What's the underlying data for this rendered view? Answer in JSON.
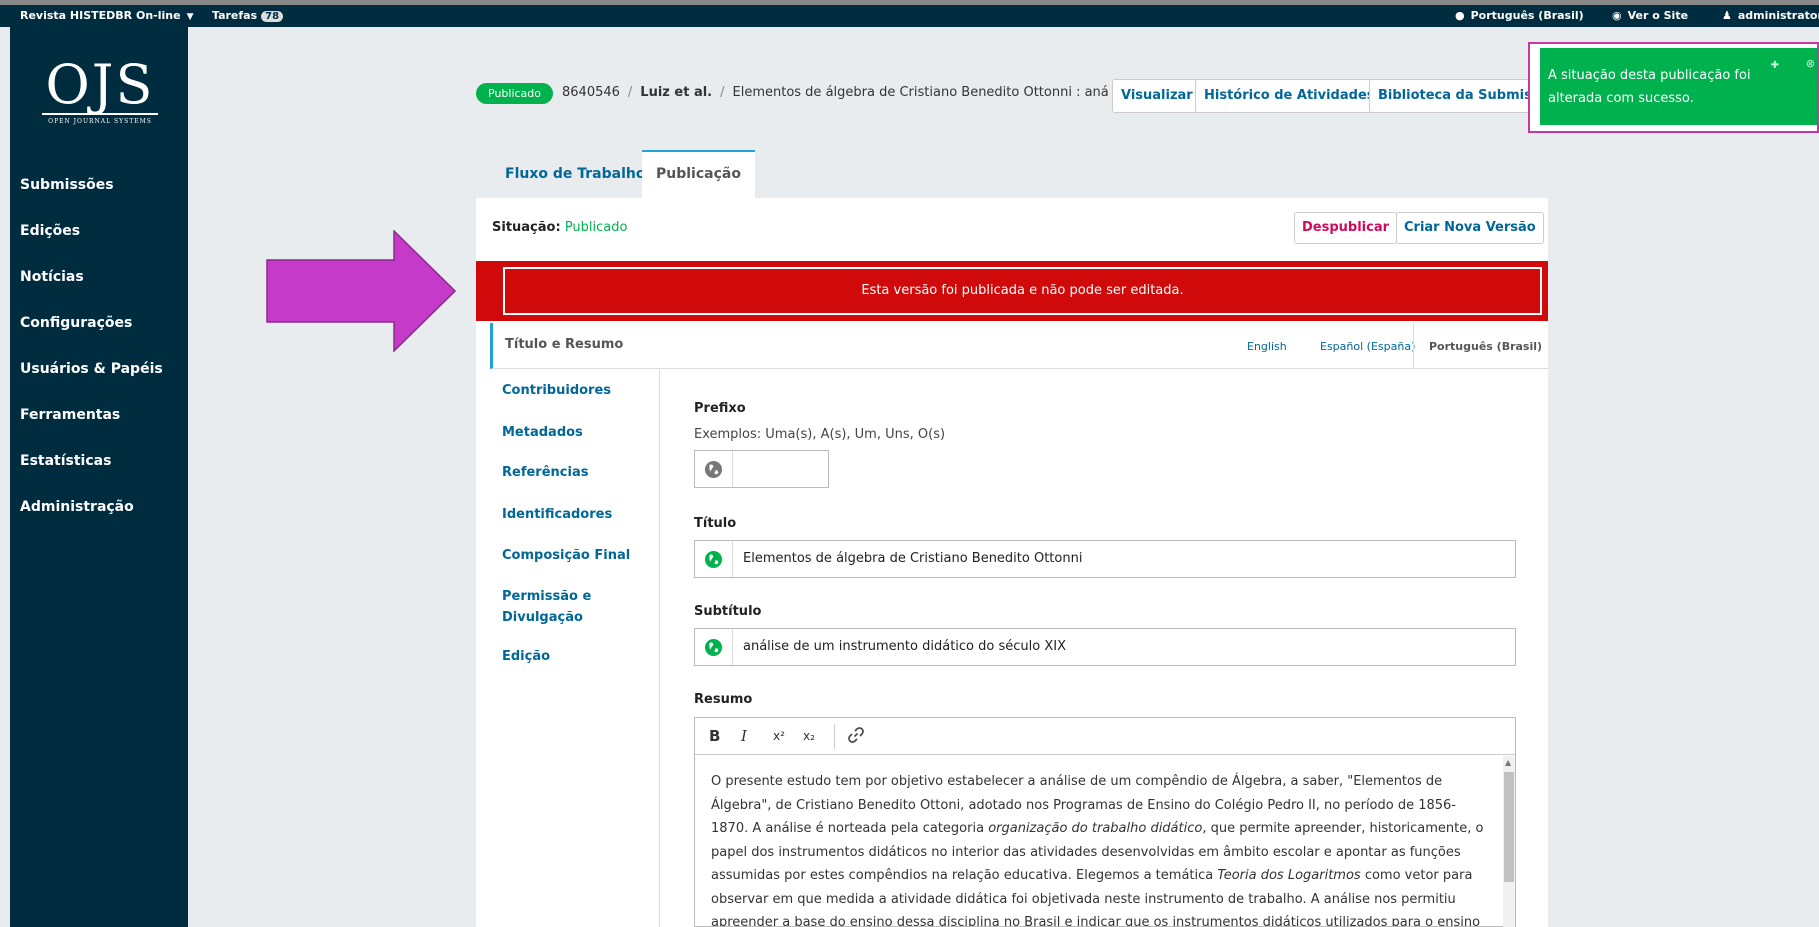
{
  "topbar": {
    "context": "Revista HISTEDBR On-line",
    "tasks_label": "Tarefas",
    "tasks_count": "78",
    "language": "Português (Brasil)",
    "view_site": "Ver o Site",
    "user": "administrator"
  },
  "logo": {
    "big": "OJS",
    "small": "OPEN JOURNAL SYSTEMS"
  },
  "sidebar": {
    "items": [
      {
        "label": "Submissões"
      },
      {
        "label": "Edições"
      },
      {
        "label": "Notícias"
      },
      {
        "label": "Configurações"
      },
      {
        "label": "Usuários & Papéis"
      },
      {
        "label": "Ferramentas"
      },
      {
        "label": "Estatísticas"
      },
      {
        "label": "Administração"
      }
    ]
  },
  "header": {
    "status": "Publicado",
    "submission_id": "8640546",
    "authors": "Luiz et al.",
    "title": "Elementos de álgebra de Cristiano Benedito Ottonni : aná",
    "sep": "/",
    "buttons": {
      "view": "Visualizar",
      "history": "Histórico de Atividades",
      "library": "Biblioteca da Submissão"
    }
  },
  "notification": {
    "text": "A situação desta publicação foi alterada com sucesso."
  },
  "tabs": {
    "workflow": "Fluxo de Trabalho",
    "publication": "Publicação"
  },
  "panel": {
    "status_label": "Situação:",
    "status_value": "Publicado",
    "unpublish": "Despublicar",
    "new_version": "Criar Nova Versão",
    "banner": "Esta versão foi publicada e não pode ser editada.",
    "section_title": "Título e Resumo",
    "languages": {
      "en": "English",
      "es": "Español (España)",
      "pt": "Português (Brasil)"
    }
  },
  "subnav": {
    "contributors": "Contribuidores",
    "metadata": "Metadados",
    "references": "Referências",
    "identifiers": "Identificadores",
    "galleys": "Composição Final",
    "permissions_1": "Permissão e",
    "permissions_2": "Divulgação",
    "issue": "Edição"
  },
  "form": {
    "prefix_label": "Prefixo",
    "prefix_hint": "Exemplos: Uma(s), A(s), Um, Uns, O(s)",
    "prefix_value": "",
    "title_label": "Título",
    "title_value": "Elementos de álgebra de Cristiano Benedito Ottonni",
    "subtitle_label": "Subtítulo",
    "subtitle_value": "análise de um instrumento didático do século XIX",
    "abstract_label": "Resumo",
    "toolbar": {
      "bold": "B",
      "italic": "I",
      "superscript": "x²",
      "subscript": "x₂"
    },
    "abstract": {
      "p1": "O presente estudo tem por objetivo estabelecer a análise de um compêndio de Álgebra, a saber, \"Elementos de Álgebra\", de Cristiano Benedito Ottoni, adotado nos Programas de Ensino do Colégio Pedro II, no período de 1856-1870. A análise é norteada pela categoria ",
      "i1": "organização do trabalho didático",
      "p2": ", que permite apreender, historicamente, o papel dos instrumentos didáticos no interior das atividades desenvolvidas em âmbito escolar e apontar as funções assumidas por estes compêndios na relação educativa. Elegemos a temática ",
      "i2": "Teoria dos Logaritmos",
      "p3": " como vetor para observar em que medida a atividade didática foi objetivada neste instrumento de trabalho. A análise nos permitiu apreender a base do ensino dessa disciplina no Brasil e indicar que os instrumentos didáticos utilizados para o ensino de álgebra, no século"
    }
  },
  "colors": {
    "navy": "#002c40",
    "link": "#006798",
    "green": "#00b24e",
    "red": "#d00a0a",
    "accent": "#c53aa0"
  }
}
